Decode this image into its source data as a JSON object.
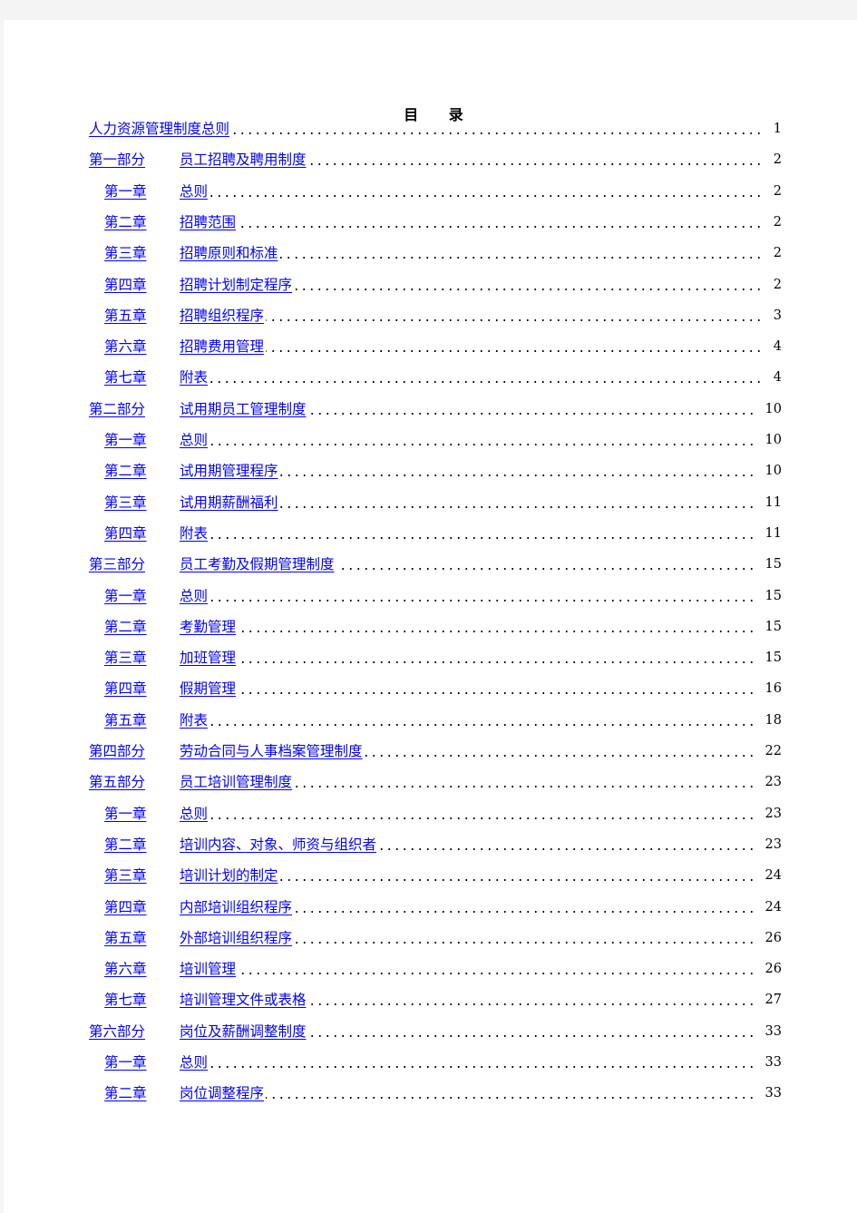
{
  "document": {
    "heading": "目 录",
    "link_color": "#0000ff",
    "entries": [
      {
        "level": "top",
        "label": "",
        "title": "人力资源管理制度总则",
        "page": "1"
      },
      {
        "level": "part",
        "label": "第一部分",
        "title": "员工招聘及聘用制度",
        "page": "2"
      },
      {
        "level": "chapter",
        "label": "第一章",
        "title": "总则",
        "page": "2"
      },
      {
        "level": "chapter",
        "label": "第二章",
        "title": "招聘范围",
        "page": "2"
      },
      {
        "level": "chapter",
        "label": "第三章",
        "title": "招聘原则和标准",
        "page": "2"
      },
      {
        "level": "chapter",
        "label": "第四章",
        "title": "招聘计划制定程序",
        "page": "2"
      },
      {
        "level": "chapter",
        "label": "第五章",
        "title": "招聘组织程序",
        "page": "3"
      },
      {
        "level": "chapter",
        "label": "第六章",
        "title": "招聘费用管理",
        "page": "4"
      },
      {
        "level": "chapter",
        "label": "第七章",
        "title": "附表",
        "page": "4"
      },
      {
        "level": "part",
        "label": "第二部分",
        "title": "试用期员工管理制度",
        "page": "10"
      },
      {
        "level": "chapter",
        "label": "第一章",
        "title": "总则",
        "page": "10"
      },
      {
        "level": "chapter",
        "label": "第二章",
        "title": "试用期管理程序",
        "page": "10"
      },
      {
        "level": "chapter",
        "label": "第三章",
        "title": "试用期薪酬福利",
        "page": "11"
      },
      {
        "level": "chapter",
        "label": "第四章",
        "title": "附表",
        "page": "11"
      },
      {
        "level": "part",
        "label": "第三部分",
        "title": "员工考勤及假期管理制度",
        "page": "15"
      },
      {
        "level": "chapter",
        "label": "第一章",
        "title": "总则",
        "page": "15"
      },
      {
        "level": "chapter",
        "label": "第二章",
        "title": "考勤管理",
        "page": "15"
      },
      {
        "level": "chapter",
        "label": "第三章",
        "title": "加班管理",
        "page": "15"
      },
      {
        "level": "chapter",
        "label": "第四章",
        "title": "假期管理",
        "page": "16"
      },
      {
        "level": "chapter",
        "label": "第五章",
        "title": "附表",
        "page": "18"
      },
      {
        "level": "part",
        "label": "第四部分",
        "title": "劳动合同与人事档案管理制度",
        "page": "22"
      },
      {
        "level": "part",
        "label": "第五部分",
        "title": "员工培训管理制度",
        "page": "23"
      },
      {
        "level": "chapter",
        "label": "第一章",
        "title": "总则",
        "page": "23"
      },
      {
        "level": "chapter",
        "label": "第二章",
        "title": "培训内容、对象、师资与组织者",
        "page": "23"
      },
      {
        "level": "chapter",
        "label": "第三章",
        "title": "培训计划的制定",
        "page": "24"
      },
      {
        "level": "chapter",
        "label": "第四章",
        "title": "内部培训组织程序",
        "page": "24"
      },
      {
        "level": "chapter",
        "label": "第五章",
        "title": "外部培训组织程序",
        "page": "26"
      },
      {
        "level": "chapter",
        "label": "第六章",
        "title": "培训管理",
        "page": "26"
      },
      {
        "level": "chapter",
        "label": "第七章",
        "title": "培训管理文件或表格",
        "page": "27"
      },
      {
        "level": "part",
        "label": "第六部分",
        "title": "岗位及薪酬调整制度",
        "page": "33"
      },
      {
        "level": "chapter",
        "label": "第一章",
        "title": "总则",
        "page": "33"
      },
      {
        "level": "chapter",
        "label": "第二章",
        "title": "岗位调整程序",
        "page": "33"
      }
    ]
  }
}
